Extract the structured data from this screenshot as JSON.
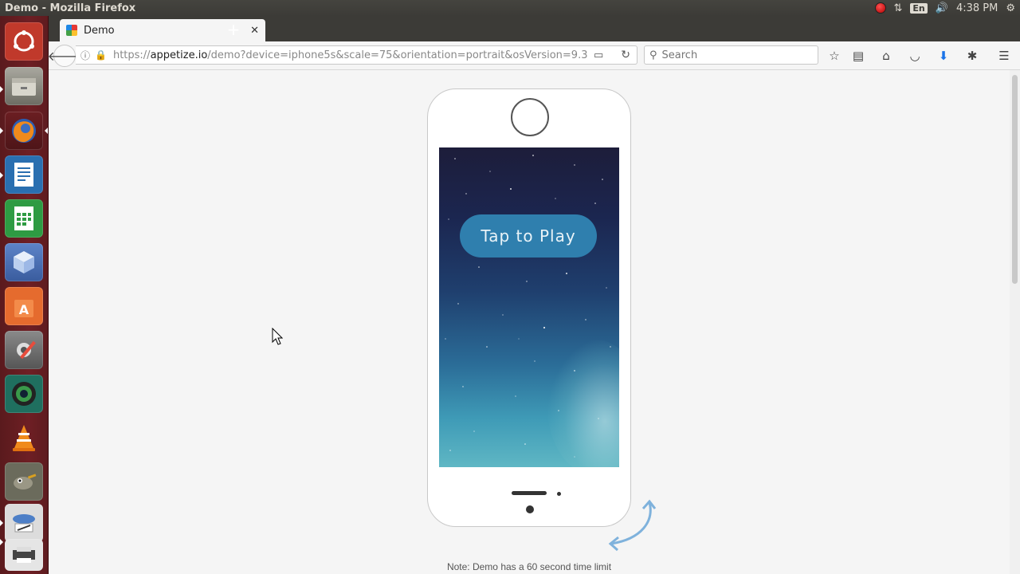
{
  "system_panel": {
    "title": "Demo - Mozilla Firefox",
    "keyboard_layout": "En",
    "time": "4:38 PM"
  },
  "launcher": {
    "items": [
      {
        "icon": "ubuntu-dash-icon",
        "color": "#c0392b"
      },
      {
        "icon": "files-icon",
        "color": "#8a8a80"
      },
      {
        "icon": "firefox-icon",
        "color": "#e66000"
      },
      {
        "icon": "writer-icon",
        "color": "#2a6fb0"
      },
      {
        "icon": "calc-icon",
        "color": "#2e9b43"
      },
      {
        "icon": "3d-cube-icon",
        "color": "#6a8fd0"
      },
      {
        "icon": "software-center-icon",
        "color": "#e56b2e"
      },
      {
        "icon": "settings-icon",
        "color": "#777"
      },
      {
        "icon": "camera-app-icon",
        "color": "#2b2b2b"
      },
      {
        "icon": "vlc-icon",
        "color": "#e98a1a"
      },
      {
        "icon": "gimp-icon",
        "color": "#6b6b5c"
      },
      {
        "icon": "remmina-icon",
        "color": "#4d7fc7"
      },
      {
        "icon": "printer-icon",
        "color": "#555"
      }
    ]
  },
  "browser": {
    "tab": {
      "label": "Demo"
    },
    "url": {
      "scheme": "https://",
      "host": "appetize.io",
      "path": "/demo?device=iphone5s&scale=75&orientation=portrait&osVersion=9.3"
    },
    "search": {
      "placeholder": "Search"
    }
  },
  "page": {
    "play_label": "Tap to Play",
    "note": "Note: Demo has a 60 second time limit"
  }
}
